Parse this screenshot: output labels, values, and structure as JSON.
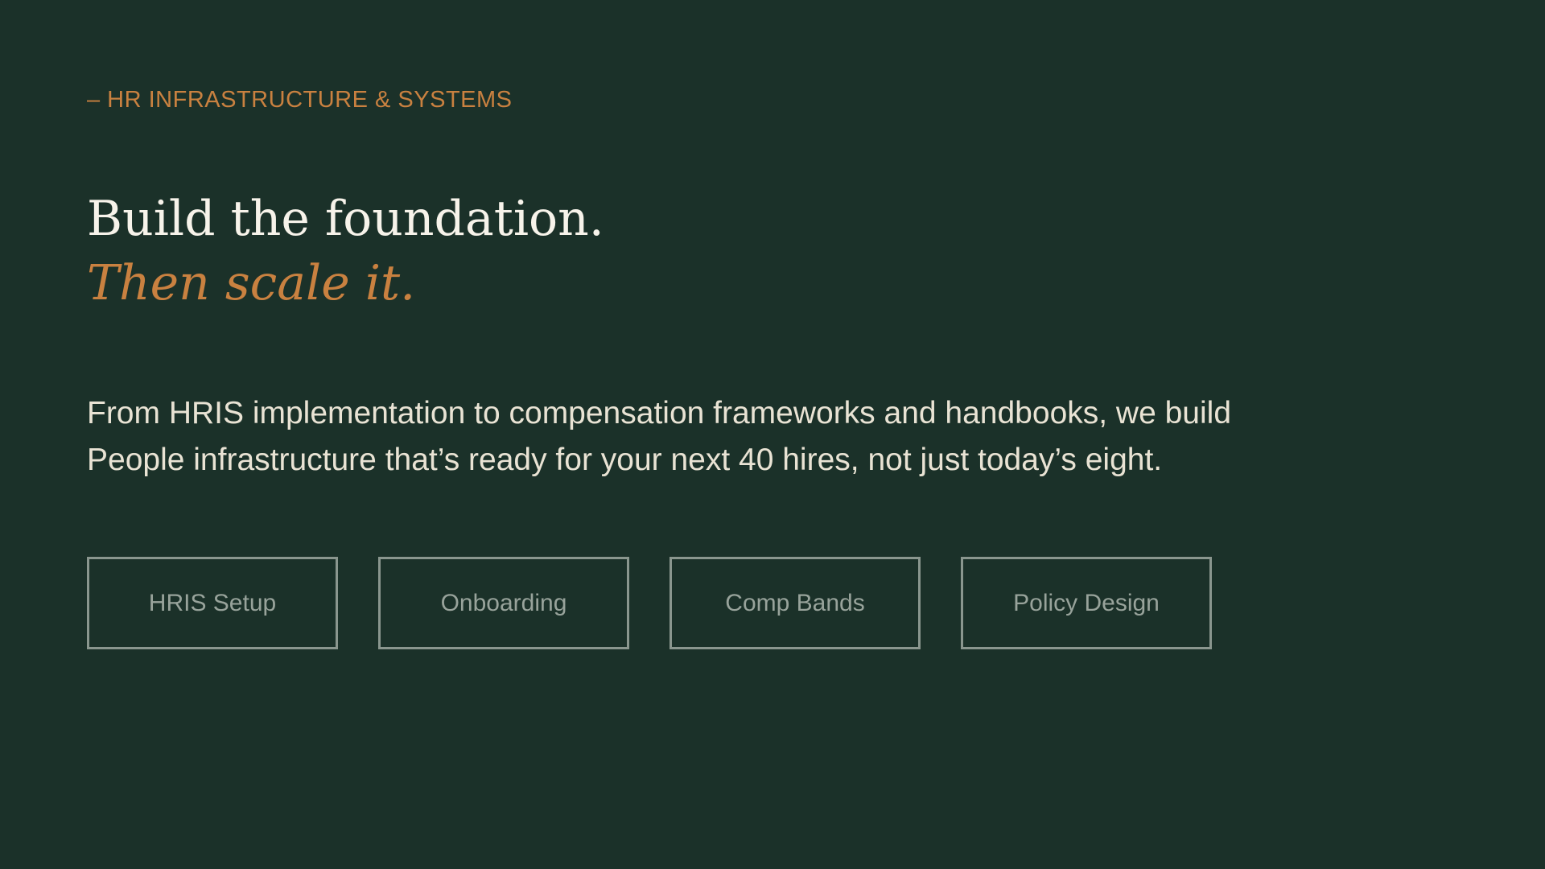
{
  "hero": {
    "eyebrow": "– HR INFRASTRUCTURE & SYSTEMS",
    "headline": "Build the foundation.",
    "headline_accent": "Then scale it.",
    "lede": "From HRIS implementation to compensation frameworks and handbooks, we build People infrastructure that’s ready for your next 40 hires, not just today’s eight."
  },
  "tags": [
    {
      "label": "HRIS Setup"
    },
    {
      "label": "Onboarding"
    },
    {
      "label": "Comp Bands"
    },
    {
      "label": "Policy Design"
    }
  ],
  "colors": {
    "background": "#1b3129",
    "accent": "#c98140",
    "headline": "#f7f3ea",
    "body": "#e9e3d4",
    "tag_border": "#8a968e",
    "tag_text": "#98a39b"
  }
}
